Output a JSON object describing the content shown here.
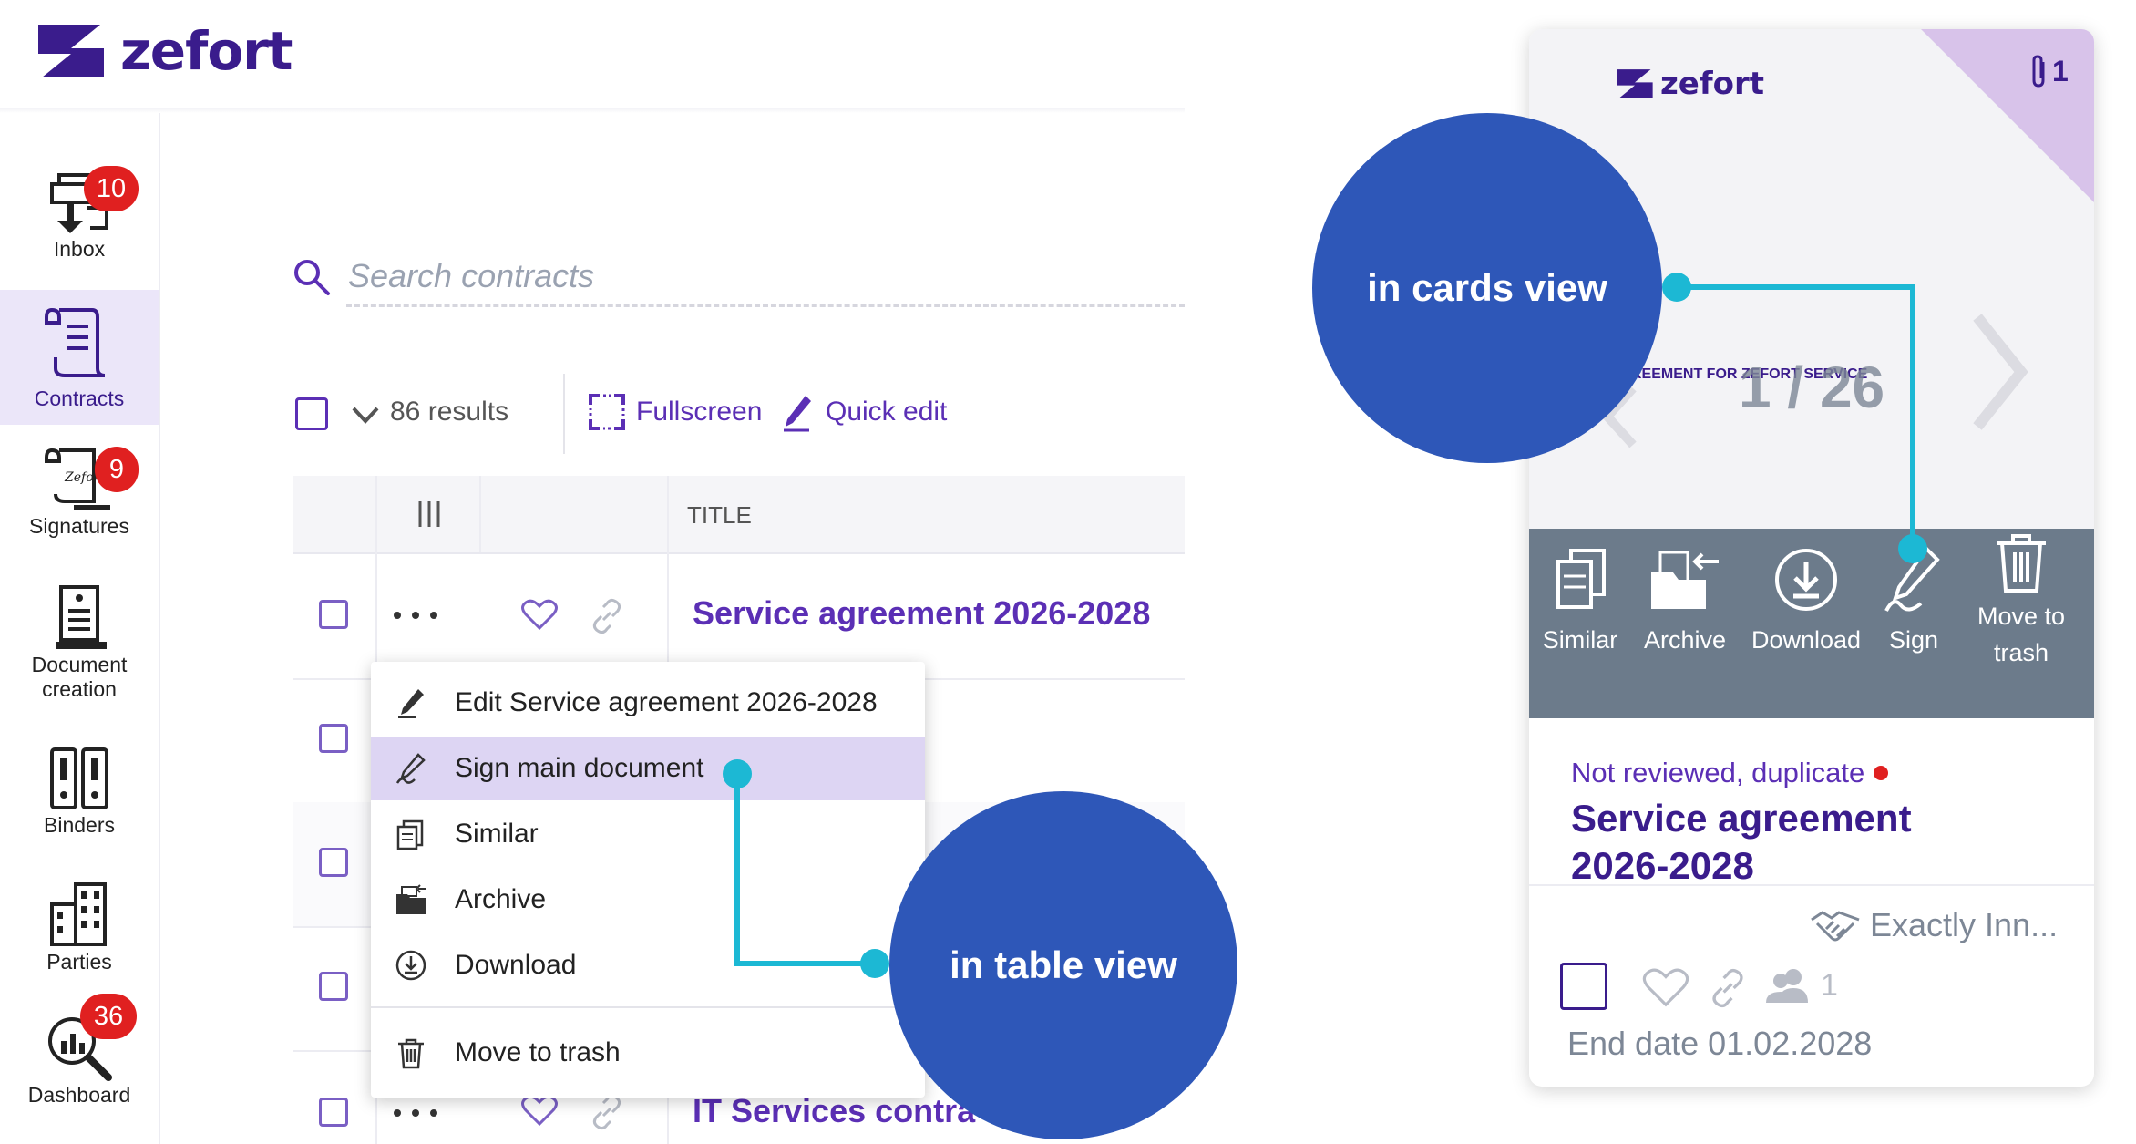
{
  "brand": {
    "name": "zefort",
    "color": "#3a1c8c",
    "accent": "#5b2fb5"
  },
  "sidebar": {
    "items": [
      {
        "label": "Inbox",
        "icon": "inbox-icon",
        "badge": "10"
      },
      {
        "label": "Contracts",
        "icon": "contracts-icon",
        "active": true
      },
      {
        "label": "Signatures",
        "icon": "signatures-icon",
        "badge": "9"
      },
      {
        "label": "Document creation",
        "icon": "document-creation-icon"
      },
      {
        "label": "Binders",
        "icon": "binders-icon"
      },
      {
        "label": "Parties",
        "icon": "parties-icon"
      },
      {
        "label": "Dashboard",
        "icon": "dashboard-icon",
        "badge": "36"
      }
    ]
  },
  "search": {
    "placeholder": "Search contracts"
  },
  "toolbar": {
    "results": "86 results",
    "fullscreen": "Fullscreen",
    "quick_edit": "Quick edit"
  },
  "table": {
    "header": {
      "title": "TITLE"
    },
    "rows": [
      {
        "title": "Service agreement 2026-2028"
      },
      {
        "title": ""
      },
      {
        "title": ""
      },
      {
        "title": ""
      },
      {
        "title": "IT Services contra"
      }
    ]
  },
  "context_menu": {
    "items": [
      {
        "label": "Edit Service agreement 2026-2028",
        "icon": "edit-icon"
      },
      {
        "label": "Sign main document",
        "icon": "sign-icon",
        "highlighted": true
      },
      {
        "label": "Similar",
        "icon": "similar-icon"
      },
      {
        "label": "Archive",
        "icon": "archive-icon"
      },
      {
        "label": "Download",
        "icon": "download-icon"
      },
      {
        "label": "Move to trash",
        "icon": "trash-icon"
      }
    ]
  },
  "callouts": {
    "table": "in table view",
    "cards": "in cards view",
    "color": "#2e57b8",
    "line_color": "#1cb8d4"
  },
  "card": {
    "attachments": "1",
    "doc_title_snippet": "REEMENT FOR ZEFORT SERVICE",
    "page_indicator": "1 / 26",
    "actions": [
      {
        "label": "Similar",
        "icon": "similar-icon"
      },
      {
        "label": "Archive",
        "icon": "archive-icon"
      },
      {
        "label": "Download",
        "icon": "download-icon"
      },
      {
        "label": "Sign",
        "icon": "sign-icon"
      },
      {
        "label": "Move to trash",
        "icon": "trash-icon"
      }
    ],
    "status": "Not reviewed, duplicate",
    "title_line1": "Service agreement",
    "title_line2": "2026-2028",
    "party": "Exactly Inn...",
    "shared_count": "1",
    "end_date": "End date 01.02.2028"
  }
}
